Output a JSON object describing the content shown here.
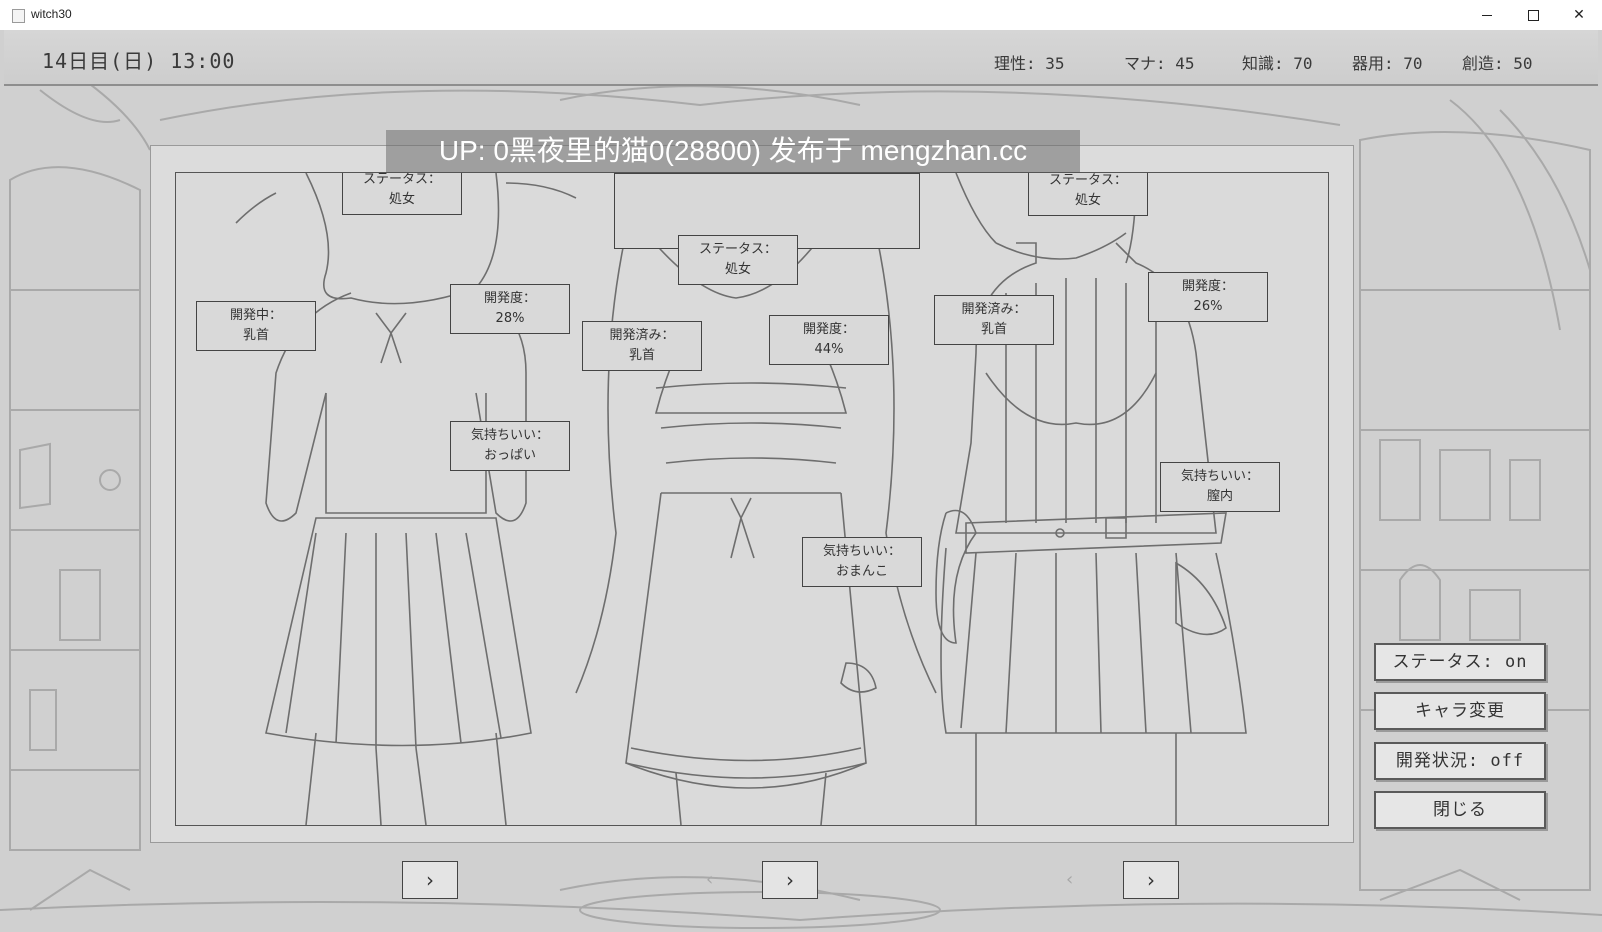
{
  "window": {
    "title": "witch30"
  },
  "hud": {
    "day": "14日目(日) 13:00",
    "stats": [
      {
        "label": "理性:",
        "value": "35"
      },
      {
        "label": "マナ:",
        "value": "45"
      },
      {
        "label": "知識:",
        "value": "70"
      },
      {
        "label": "器用:",
        "value": "70"
      },
      {
        "label": "創造:",
        "value": "50"
      }
    ]
  },
  "watermark": "UP: 0黑夜里的猫0(28800) 发布于 mengzhan.cc",
  "characters": [
    {
      "status": {
        "title": "ステータス：",
        "value": "処女"
      },
      "dev_part": {
        "title": "開発中：",
        "value": "乳首"
      },
      "dev_level": {
        "title": "開発度：",
        "value": "28%"
      },
      "pleasure": {
        "title": "気持ちいい：",
        "value": "おっぱい"
      }
    },
    {
      "status": {
        "title": "ステータス：",
        "value": "処女"
      },
      "dev_part": {
        "title": "開発済み：",
        "value": "乳首"
      },
      "dev_level": {
        "title": "開発度：",
        "value": "44%"
      },
      "pleasure": {
        "title": "気持ちいい：",
        "value": "おまんこ"
      }
    },
    {
      "status": {
        "title": "ステータス：",
        "value": "処女"
      },
      "dev_part": {
        "title": "開発済み：",
        "value": "乳首"
      },
      "dev_level": {
        "title": "開発度：",
        "value": "26%"
      },
      "pleasure": {
        "title": "気持ちいい：",
        "value": "膣内"
      }
    }
  ],
  "menu": {
    "status_toggle": "ステータス: on",
    "change_char": "キャラ変更",
    "dev_toggle": "開発状況: off",
    "close": "閉じる"
  },
  "nav": {
    "next": "›",
    "prev": "‹"
  }
}
